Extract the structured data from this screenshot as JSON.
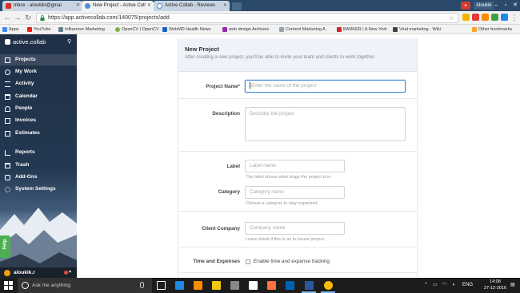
{
  "browser": {
    "tabs": [
      {
        "label": "Inbox - aloukikr@gmai",
        "active": false
      },
      {
        "label": "New Project - Active Coll",
        "active": true
      },
      {
        "label": "Active Collab - Reviews",
        "active": false
      }
    ],
    "user_label": "Aloukik",
    "url": "https://app.activecollab.com/140075/projects/add",
    "bookmarks": [
      "Apps",
      "YouTube",
      "Influencer Marketing",
      "OpenCV | OpenCV",
      "WebMD Health News",
      "web design Archives",
      "Content Marketing A",
      "BARKER | A New York",
      "Viral marketing - Wiki",
      "Other bookmarks"
    ]
  },
  "sidebar": {
    "brand": "active.collab",
    "items": [
      {
        "label": "Projects",
        "active": true
      },
      {
        "label": "My Work"
      },
      {
        "label": "Activity"
      },
      {
        "label": "Calendar"
      },
      {
        "label": "People"
      },
      {
        "label": "Invoices"
      },
      {
        "label": "Estimates"
      },
      {
        "label": "Reports"
      },
      {
        "label": "Trash"
      },
      {
        "label": "Add-Ons"
      },
      {
        "label": "System Settings"
      }
    ],
    "help": "Help",
    "user": "aloukik.r"
  },
  "form": {
    "title": "New Project",
    "subtitle": "After creating a new project, you'll be able to invite your team and clients to work together.",
    "project_name_label": "Project Name*",
    "project_name_placeholder": "Enter the name of the project",
    "description_label": "Description",
    "description_placeholder": "Describe the project",
    "label_label": "Label",
    "label_placeholder": "Label name",
    "label_hint": "The label shows what stage the project is in.",
    "category_label": "Category",
    "category_placeholder": "Category name",
    "category_hint": "Choose a category to stay organized.",
    "client_label": "Client Company",
    "client_placeholder": "Company name",
    "client_hint": "Leave blank if this is an in-house project.",
    "time_label": "Time and Expenses",
    "time_checkbox_label": "Enable time and expense tracking"
  },
  "taskbar": {
    "search_placeholder": "Ask me anything",
    "lang": "ENG",
    "time": "14:08",
    "date": "27-12-2016"
  },
  "colors": {
    "accent": "#4a90d9",
    "help": "#4caf50",
    "chrome_frame": "#2b4a6b"
  }
}
